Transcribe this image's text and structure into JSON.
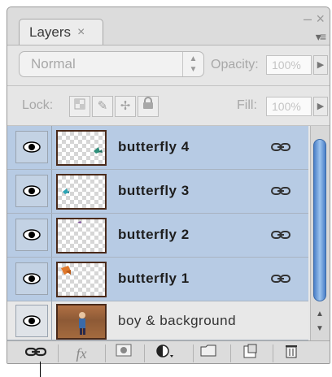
{
  "panel": {
    "tab_label": "Layers",
    "tab_close": "×",
    "minimize_glyph": "–",
    "close_glyph": "×",
    "menu_glyph": "▾≡"
  },
  "blend": {
    "mode": "Normal",
    "opacity_label": "Opacity:",
    "opacity_value": "100%"
  },
  "lock": {
    "label": "Lock:",
    "fill_label": "Fill:",
    "fill_value": "100%"
  },
  "layers": [
    {
      "name": "butterfly 4",
      "selected": true,
      "linked": true,
      "thumb": "checker"
    },
    {
      "name": "butterfly 3",
      "selected": true,
      "linked": true,
      "thumb": "checker"
    },
    {
      "name": "butterfly 2",
      "selected": true,
      "linked": true,
      "thumb": "checker"
    },
    {
      "name": "butterfly 1",
      "selected": true,
      "linked": true,
      "thumb": "checker"
    },
    {
      "name": "boy & background",
      "selected": false,
      "linked": false,
      "thumb": "photo"
    }
  ],
  "bottom": {
    "fx_label": "fx",
    "icons": [
      "link-layers-icon",
      "fx-icon",
      "layer-mask-icon",
      "adjustment-layer-icon",
      "new-group-icon",
      "new-layer-icon",
      "trash-icon"
    ]
  },
  "colors": {
    "selection": "#b7cbe4",
    "scroll_thumb": "#4a7fc8"
  }
}
